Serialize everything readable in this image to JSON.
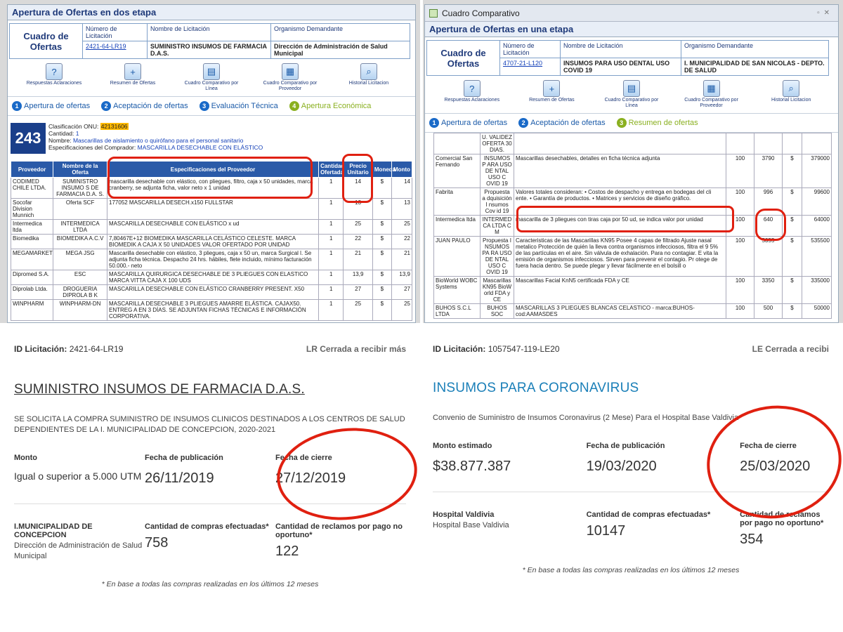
{
  "q1": {
    "title": "Apertura de Ofertas en dos etapa",
    "cuadro": "Cuadro de Ofertas",
    "h_numero": "Número de Licitación",
    "h_nombre": "Nombre de Licitación",
    "h_org": "Organismo Demandante",
    "numero": "2421-64-LR19",
    "nombre": "SUMINISTRO INSUMOS DE FARMACIA D.A.S.",
    "org": "Dirección de Administración de Salud Municipal",
    "icons": [
      "Respuestas Aclaraciones",
      "Resumen de Ofertas",
      "Cuadro Comparativo por Línea",
      "Cuadro Comparativo por Proveedor",
      "Historial Licitacion"
    ],
    "steps": [
      "Apertura de ofertas",
      "Aceptación de ofertas",
      "Evaluación Técnica",
      "Apertura Económica"
    ],
    "item_num": "243",
    "onu_label": "Clasificación ONU:",
    "onu": "42131606",
    "cantidad_label": "Cantidad:",
    "cantidad": "1",
    "nombre_label": "Nombre:",
    "nombre_item": "Mascarillas de aislamiento o quirófano para el personal sanitario",
    "espec_label": "Especificaciones del Comprador:",
    "espec": "MASCARILLA DESECHABLE CON ELÁSTICO",
    "cols": [
      "Proveedor",
      "Nombre de la Oferta",
      "Especificaciones del Proveedor",
      "Cantidad Ofertada",
      "Precio Unitario",
      "Moneda",
      "Monto"
    ],
    "rows": [
      [
        "CODIMED CHILE LTDA.",
        "SUMINISTRO INSUMO S DE FARMACIA D.A. S.",
        "mascarilla desechable con elástico, con pliegues, filtro, caja x 50 unidades, marca cranberry, se adjunta ficha, valor neto x 1 unidad",
        "1",
        "14",
        "$",
        "14"
      ],
      [
        "Socofar Division Munnich",
        "Oferta SCF",
        "177052 MASCARILLA DESECH.x150 FULLSTAR",
        "1",
        "13",
        "$",
        "13"
      ],
      [
        "Intermedica ltda",
        "INTERMEDICA LTDA",
        "MASCARILLA DESECHABLE CON ELÁSTICO x ud",
        "1",
        "25",
        "$",
        "25"
      ],
      [
        "Biomedika",
        "BIOMEDIKA A.C.V",
        "7,80467E+12 BIOMEDIKA MASCARILLA CELÁSTICO CELESTE. MARCA BIOMEDIK A CAJA X 50 UNIDADES VALOR OFERTADO POR UNIDAD",
        "1",
        "22",
        "$",
        "22"
      ],
      [
        "MEGAMARKET",
        "MEGA JSG",
        "Mascarilla desechable con elástico, 3 pliegues, caja x 50 un, marca Surgical l. Se adjunta ficha técnica. Despacho 24 hrs. hábiles, flete incluido, mínimo facturación 50.000.- neto",
        "1",
        "21",
        "$",
        "21"
      ],
      [
        "Dipromed S.A.",
        "ESC",
        "MASCARILLA QUIRURGICA DESECHABLE DE 3 PLIEGUES CON ELASTICO MARCA VITTA CAJA X 100 UDS",
        "1",
        "13,9",
        "$",
        "13,9"
      ],
      [
        "Diprolab Ltda.",
        "DROGUERIA DIPROLA B K",
        "MASCARILLA DESECHABLE CON ELÁSTICO CRANBERRY PRESENT. X50",
        "1",
        "27",
        "$",
        "27"
      ],
      [
        "WINPHARM",
        "WINPHARM-DN",
        "MASCARILLA DESECHABLE 3 PLIEGUES AMARRE ELÁSTICA. CAJAX50. ENTREG A EN 3 DÍAS. SE ADJUNTAN FICHAS TÉCNICAS E INFORMACIÓN CORPORATIVA.",
        "1",
        "25",
        "$",
        "25"
      ]
    ]
  },
  "q2": {
    "window_title": "Cuadro Comparativo",
    "title": "Apertura de Ofertas en una etapa",
    "cuadro": "Cuadro de Ofertas",
    "h_numero": "Número de Licitación",
    "h_nombre": "Nombre de Licitación",
    "h_org": "Organismo Demandante",
    "numero": "4707-21-L120",
    "nombre": "INSUMOS PARA USO DENTAL USO COVID 19",
    "org": "I. MUNICIPALIDAD DE SAN NICOLAS - DEPTO. DE SALUD",
    "icons": [
      "Respuestas Aclaraciones",
      "Resumen de Ofertas",
      "Cuadro Comparativo por Línea",
      "Cuadro Comparativo por Proveedor",
      "Historial Licitacion"
    ],
    "steps": [
      "Apertura de ofertas",
      "Aceptación de ofertas",
      "Resumen de ofertas"
    ],
    "rows": [
      [
        "",
        "U. VALIDEZ OFERTA 30 DIAS.",
        "",
        "",
        "",
        "",
        ""
      ],
      [
        "Comercial San Fernando",
        "INSUMOS P ARA USO DE NTAL USO C OVID 19",
        "Mascarillas desechables, detalles en ficha técnica adjunta",
        "100",
        "3790",
        "$",
        "379000"
      ],
      [
        "Fabrita",
        "Propuesta a dquisición I nsumos Cov id 19",
        "Valores totales consideran: • Costos de despacho y entrega en bodegas del cli ente. • Garantía de productos. • Matrices y servicios de diseño gráfico.",
        "100",
        "996",
        "$",
        "99600"
      ],
      [
        "Intermedica ltda",
        "INTERMED CA LTDA C M",
        "mascarilla de 3 pliegues con tiras caja por 50 ud, se indica valor por unidad",
        "100",
        "640",
        "$",
        "64000"
      ],
      [
        "JUAN PAULO",
        "Propuesta I NSUMOS PA RA USO DE NTAL USO C OVID 19",
        "Caracteristicas de las Mascarillas KN95 Posee 4 capas de filtrado Ajuste nasal metalico Protección de quién la lleva contra organismos infecciosos, filtra el 9 5% de las partículas en el aire. Sin válvula de exhalación. Para no contagiar. E vita la emisión de organismos infecciosos. Sirven para prevenir el contagio. Pr otege de fuera hacia dentro. Se puede plegar y llevar fácilmente en el bolsill o",
        "100",
        "5355",
        "$",
        "535500"
      ],
      [
        "BioWorld WOBC Systems",
        "Mascarillas KN95 BioW orld FDA y CE",
        "Mascarillas Facial KnN5 certificada FDA y CE",
        "100",
        "3350",
        "$",
        "335000"
      ],
      [
        "BUHOS S.C.L LTDA",
        "BUHOS SOC",
        "MASCARILLAS 3 PLIEGUES BLANCAS CELASTICO - marca:BUHOS- cod:AAMASDES",
        "100",
        "500",
        "$",
        "50000"
      ]
    ]
  },
  "q3": {
    "id_label": "ID Licitación:",
    "id": "2421-64-LR19",
    "status": "LR Cerrada a recibir más",
    "title": "SUMINISTRO INSUMOS DE FARMACIA D.A.S.",
    "desc": "SE SOLICITA LA COMPRA SUMINISTRO DE INSUMOS CLINICOS DESTINADOS A LOS CENTROS DE SALUD DEPENDIENTES DE LA I. MUNICIPALIDAD DE CONCEPCION, 2020-2021",
    "monto_label": "Monto",
    "monto": "Igual o superior a 5.000 UTM",
    "pub_label": "Fecha de publicación",
    "pub": "26/11/2019",
    "cierre_label": "Fecha de cierre",
    "cierre": "27/12/2019",
    "org": "I.MUNICIPALIDAD DE CONCEPCION",
    "org_sub": "Dirección de Administración de Salud Municipal",
    "compras_label": "Cantidad de compras efectuadas*",
    "compras": "758",
    "reclamos_label": "Cantidad de reclamos por pago no oportuno*",
    "reclamos": "122",
    "note": "* En base a todas las compras realizadas en los últimos 12 meses"
  },
  "q4": {
    "id_label": "ID Licitación:",
    "id": "1057547-119-LE20",
    "status": "LE Cerrada a recibi",
    "title": "INSUMOS PARA CORONAVIRUS",
    "desc": "Convenio de Suministro de Insumos Coronavirus (2 Mese) Para el Hospital Base Valdivia",
    "monto_label": "Monto estimado",
    "monto": "$38.877.387",
    "pub_label": "Fecha de publicación",
    "pub": "19/03/2020",
    "cierre_label": "Fecha de cierre",
    "cierre": "25/03/2020",
    "org": "Hospital Valdivia",
    "org_sub": "Hospital Base Valdivia",
    "compras_label": "Cantidad de compras efectuadas*",
    "compras": "10147",
    "reclamos_label": "Cantidad de reclamos por pago no oportuno*",
    "reclamos": "354",
    "note": "* En base a todas las compras realizadas en los últimos 12 meses"
  }
}
